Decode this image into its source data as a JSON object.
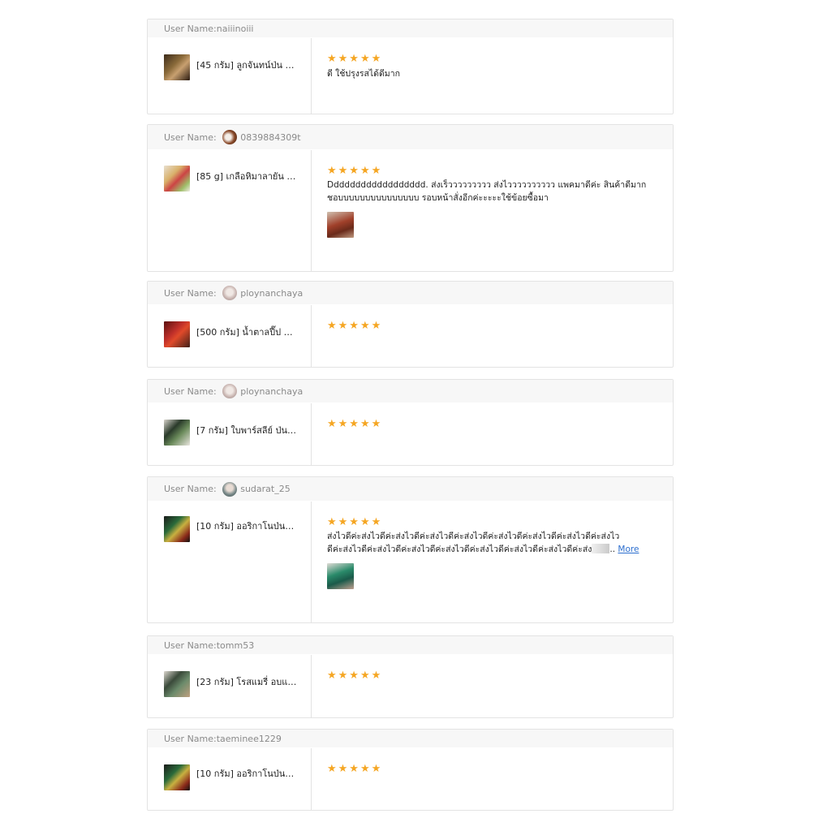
{
  "reviews": [
    {
      "user_prefix": "User Name:",
      "username": "naiiinoiii",
      "product_name": "[45 กรัม] ลูกจันทน์ป่น นั…",
      "stars": "★★★★★",
      "text": "ดี ใช้ปรุงรสได้ดีมาก"
    },
    {
      "user_prefix": "User Name: ",
      "username": "0839884309t",
      "product_name": "[85 g] เกลือหิมาลายัน เ…",
      "stars": "★★★★★",
      "text_line1": "Dddddddddddddddddd. ส่งเร็ววววววววว ส่งไวววววววววว แพคมาดีค่ะ สินค้าดีมาก",
      "text_line2": "ชอบบบบบบบบบบบบบบบ รอบหน้าสั่งอีกค่ะะะะะใช้ข้อยซื้อมา"
    },
    {
      "user_prefix": "User Name: ",
      "username": "ploynanchaya",
      "product_name": "[500 กรัม] น้ำตาลปี๊ป ต…",
      "stars": "★★★★★"
    },
    {
      "user_prefix": "User Name: ",
      "username": "ploynanchaya",
      "product_name": "[7 กรัม] ใบพาร์สลีย์ ป่น…",
      "stars": "★★★★★"
    },
    {
      "user_prefix": "User Name: ",
      "username": "sudarat_25",
      "product_name": "[10 กรัม] ออริกาโนป่นอ…",
      "stars": "★★★★★",
      "text_line1": "ส่งไวดีค่ะส่งไวดีค่ะส่งไวดีค่ะส่งไวดีค่ะส่งไวดีค่ะส่งไวดีค่ะส่งไวดีค่ะส่งไวดีค่ะส่งไว",
      "text_line2": "ดีค่ะส่งไวดีค่ะส่งไวดีค่ะส่งไวดีค่ะส่งไวดีค่ะส่งไวดีค่ะส่งไวดีค่ะส่งไวดีค่ะส่ง",
      "ellipsis": "..",
      "more_label": "More"
    },
    {
      "user_prefix": "User Name:",
      "username": "tomm53",
      "product_name": "[23 กรัม] โรสแมรี่ อบแ…",
      "stars": "★★★★★"
    },
    {
      "user_prefix": "User Name:",
      "username": "taeminee1229",
      "product_name": "[10 กรัม] ออริกาโนป่นอ…",
      "stars": "★★★★★"
    }
  ]
}
